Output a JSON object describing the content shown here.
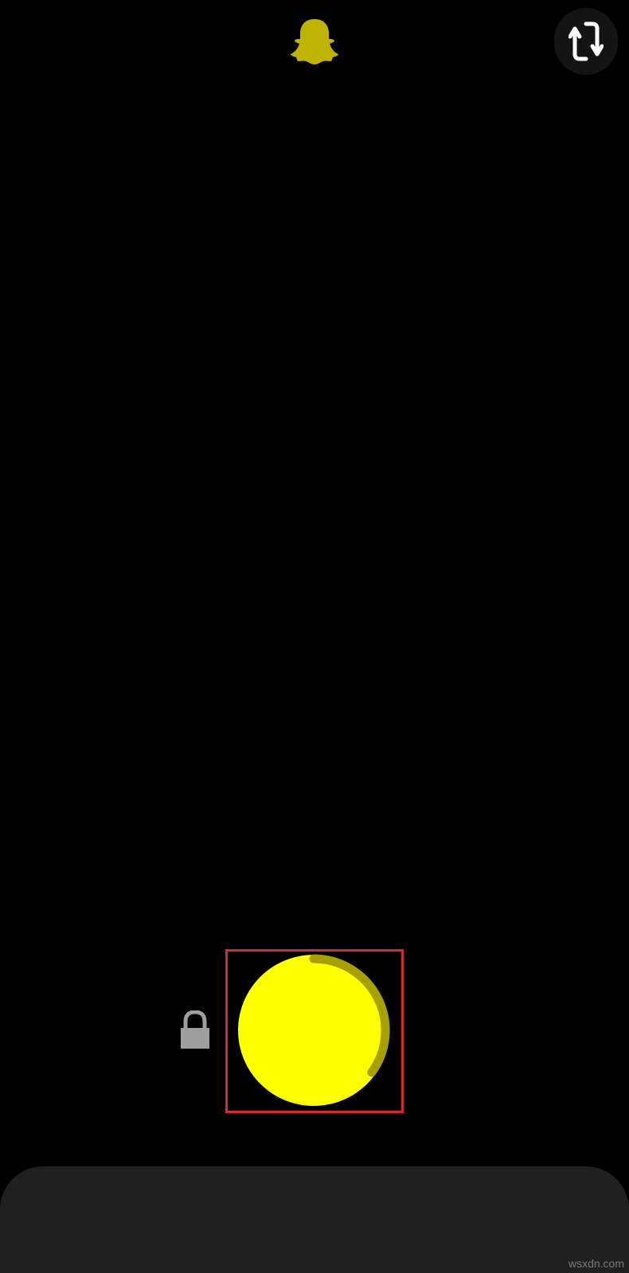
{
  "colors": {
    "background": "#000000",
    "brand_yellow": "#FFFF00",
    "logo_yellow": "#BDB300",
    "progress_ring": "#A8A000",
    "highlight_box": "#D22C2C",
    "bottom_sheet": "#202020",
    "lock_gray": "#9E9E9E"
  },
  "top_bar": {
    "logo_icon": "snapchat-ghost-icon",
    "flip_camera_icon": "flip-camera-icon"
  },
  "capture": {
    "lock_icon": "lock-icon",
    "record_button_icon": "record-circle-icon",
    "recording_progress": 0.35
  },
  "watermark": "wsxdn.com"
}
